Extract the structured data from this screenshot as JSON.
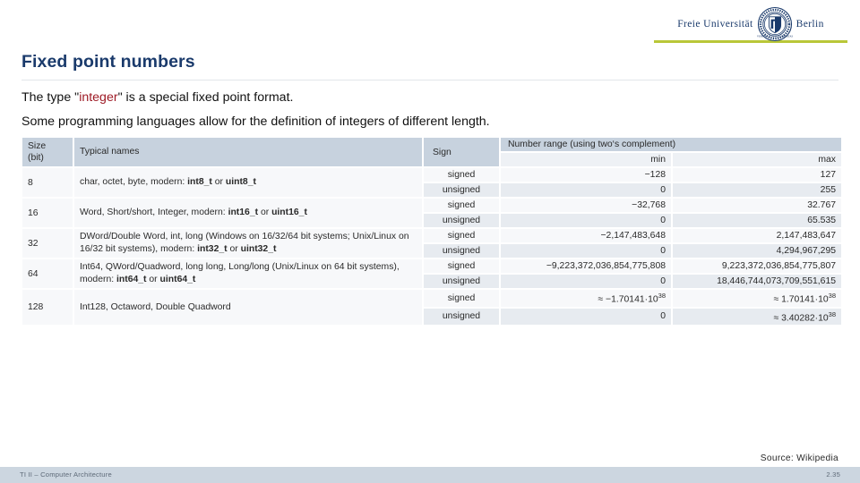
{
  "logo": {
    "left_word": "Freie Universität",
    "right_word": "Berlin",
    "seal_name": "fu-berlin-seal"
  },
  "title": "Fixed point numbers",
  "body": {
    "line1_pre": "The type \"",
    "line1_keyword": "integer",
    "line1_post": "\" is a special fixed point format.",
    "line2": "Some programming languages allow for the definition of integers of different length."
  },
  "table": {
    "headers": {
      "size": "Size",
      "size_unit": "(bit)",
      "typical_names": "Typical names",
      "sign": "Sign",
      "number_range": "Number range (using two‘s complement)",
      "min": "min",
      "max": "max"
    },
    "rows": [
      {
        "size": "8",
        "names_plain_1": "char, octet, byte, modern: ",
        "names_bold_1": "int8_t",
        "names_plain_2": " or ",
        "names_bold_2": "uint8_t",
        "names_plain_3": "",
        "signed": {
          "sign": "signed",
          "min": "−128",
          "max": "127"
        },
        "unsigned": {
          "sign": "unsigned",
          "min": "0",
          "max": "255"
        }
      },
      {
        "size": "16",
        "names_plain_1": "Word, Short/short, Integer, modern: ",
        "names_bold_1": "int16_t",
        "names_plain_2": " or ",
        "names_bold_2": "uint16_t",
        "names_plain_3": "",
        "signed": {
          "sign": "signed",
          "min": "−32,768",
          "max": "32.767"
        },
        "unsigned": {
          "sign": "unsigned",
          "min": "0",
          "max": "65.535"
        }
      },
      {
        "size": "32",
        "names_plain_1": "DWord/Double Word, int, long (Windows on 16/32/64 bit systems; Unix/Linux on 16/32 bit systems), modern: ",
        "names_bold_1": "int32_t",
        "names_plain_2": " or ",
        "names_bold_2": "uint32_t",
        "names_plain_3": "",
        "signed": {
          "sign": "signed",
          "min": "−2,147,483,648",
          "max": "2,147,483,647"
        },
        "unsigned": {
          "sign": "unsigned",
          "min": "0",
          "max": "4,294,967,295"
        }
      },
      {
        "size": "64",
        "names_plain_1": "Int64, QWord/Quadword, long long, Long/long (Unix/Linux on 64 bit systems), modern: ",
        "names_bold_1": "int64_t",
        "names_plain_2": " or ",
        "names_bold_2": "uint64_t",
        "names_plain_3": "",
        "signed": {
          "sign": "signed",
          "min": "−9,223,372,036,854,775,808",
          "max": "9,223,372,036,854,775,807"
        },
        "unsigned": {
          "sign": "unsigned",
          "min": "0",
          "max": "18,446,744,073,709,551,615"
        }
      },
      {
        "size": "128",
        "names_plain_1": "Int128, Octaword, Double Quadword",
        "names_bold_1": "",
        "names_plain_2": "",
        "names_bold_2": "",
        "names_plain_3": "",
        "signed": {
          "sign": "signed",
          "min": "≈ −1.70141·10",
          "min_exp": "38",
          "max": "≈ 1.70141·10",
          "max_exp": "38"
        },
        "unsigned": {
          "sign": "unsigned",
          "min": "0",
          "min_exp": "",
          "max": "≈ 3.40282·10",
          "max_exp": "38"
        }
      }
    ]
  },
  "source_note": "Source: Wikipedia",
  "footer": {
    "left": "TI II – Computer Architecture",
    "right": "2.35"
  },
  "colors": {
    "title_blue": "#1a3a6b",
    "keyword_red": "#9e1b26",
    "header_bg": "#c7d2de",
    "subheader_bg": "#eef1f5",
    "row_light": "#f7f8fa",
    "row_shaded": "#e7ebf0",
    "footer_bg": "#ccd6e0",
    "logo_rule_green": "#b9c738"
  }
}
